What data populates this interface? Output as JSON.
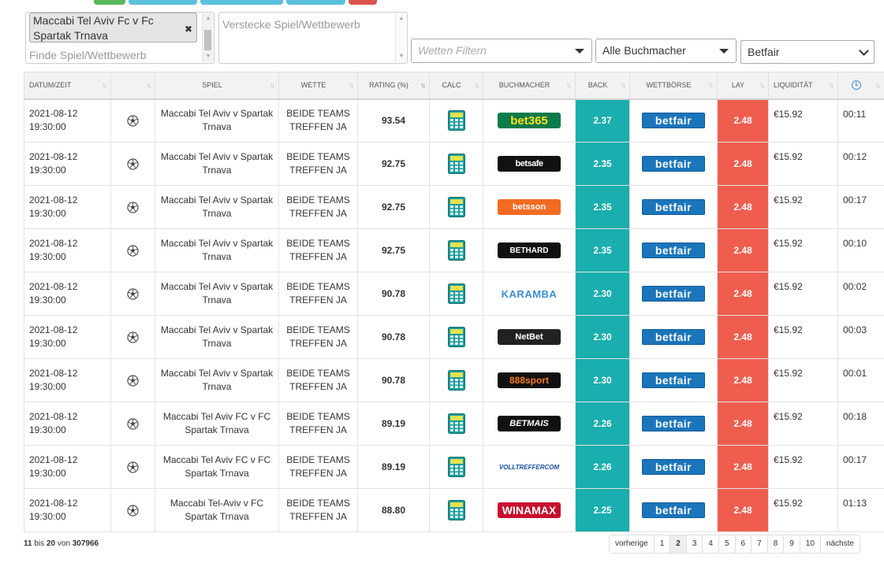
{
  "filters": {
    "match_tag": "Maccabi Tel Aviv Fc v Fc Spartak Trnava",
    "find_placeholder": "Finde Spiel/Wettbewerb",
    "hide_placeholder": "Verstecke Spiel/Wettbewerb",
    "bet_filter_placeholder": "Wetten Filtern",
    "bookmaker_select": "Alle Buchmacher",
    "exchange_select": "Betfair"
  },
  "table": {
    "headers": [
      "Datum/Zeit",
      "",
      "Spiel",
      "Wette",
      "Rating (%)",
      "Calc",
      "Buchmacher",
      "Back",
      "Wettbörse",
      "Lay",
      "Liquidität",
      ""
    ],
    "rows": [
      {
        "date": "2021-08-12",
        "time": "19:30:00",
        "match": "Maccabi Tel Aviv v Spartak Trnava",
        "bet": "BEIDE TEAMS TREFFEN JA",
        "rating": "93.54",
        "bookmaker": "bet365",
        "back": "2.37",
        "exchange": "betfair",
        "lay": "2.48",
        "liquidity": "€15.92",
        "age": "00:11"
      },
      {
        "date": "2021-08-12",
        "time": "19:30:00",
        "match": "Maccabi Tel Aviv v Spartak Trnava",
        "bet": "BEIDE TEAMS TREFFEN JA",
        "rating": "92.75",
        "bookmaker": "betsafe",
        "back": "2.35",
        "exchange": "betfair",
        "lay": "2.48",
        "liquidity": "€15.92",
        "age": "00:12"
      },
      {
        "date": "2021-08-12",
        "time": "19:30:00",
        "match": "Maccabi Tel Aviv v Spartak Trnava",
        "bet": "BEIDE TEAMS TREFFEN JA",
        "rating": "92.75",
        "bookmaker": "betsson",
        "back": "2.35",
        "exchange": "betfair",
        "lay": "2.48",
        "liquidity": "€15.92",
        "age": "00:17"
      },
      {
        "date": "2021-08-12",
        "time": "19:30:00",
        "match": "Maccabi Tel Aviv v Spartak Trnava",
        "bet": "BEIDE TEAMS TREFFEN JA",
        "rating": "92.75",
        "bookmaker": "BETHARD",
        "back": "2.35",
        "exchange": "betfair",
        "lay": "2.48",
        "liquidity": "€15.92",
        "age": "00:10"
      },
      {
        "date": "2021-08-12",
        "time": "19:30:00",
        "match": "Maccabi Tel Aviv v Spartak Trnava",
        "bet": "BEIDE TEAMS TREFFEN JA",
        "rating": "90.78",
        "bookmaker": "KARAMBA",
        "back": "2.30",
        "exchange": "betfair",
        "lay": "2.48",
        "liquidity": "€15.92",
        "age": "00:02"
      },
      {
        "date": "2021-08-12",
        "time": "19:30:00",
        "match": "Maccabi Tel Aviv v Spartak Trnava",
        "bet": "BEIDE TEAMS TREFFEN JA",
        "rating": "90.78",
        "bookmaker": "NetBet",
        "back": "2.30",
        "exchange": "betfair",
        "lay": "2.48",
        "liquidity": "€15.92",
        "age": "00:03"
      },
      {
        "date": "2021-08-12",
        "time": "19:30:00",
        "match": "Maccabi Tel Aviv v Spartak Trnava",
        "bet": "BEIDE TEAMS TREFFEN JA",
        "rating": "90.78",
        "bookmaker": "888sport",
        "back": "2.30",
        "exchange": "betfair",
        "lay": "2.48",
        "liquidity": "€15.92",
        "age": "00:01"
      },
      {
        "date": "2021-08-12",
        "time": "19:30:00",
        "match": "Maccabi Tel Aviv FC v FC Spartak Trnava",
        "bet": "BEIDE TEAMS TREFFEN JA",
        "rating": "89.19",
        "bookmaker": "BETMAIS",
        "back": "2.26",
        "exchange": "betfair",
        "lay": "2.48",
        "liquidity": "€15.92",
        "age": "00:18"
      },
      {
        "date": "2021-08-12",
        "time": "19:30:00",
        "match": "Maccabi Tel Aviv FC v FC Spartak Trnava",
        "bet": "BEIDE TEAMS TREFFEN JA",
        "rating": "89.19",
        "bookmaker": "VOLLTREFFERCOM",
        "back": "2.26",
        "exchange": "betfair",
        "lay": "2.48",
        "liquidity": "€15.92",
        "age": "00:17"
      },
      {
        "date": "2021-08-12",
        "time": "19:30:00",
        "match": "Maccabi Tel-Aviv v FC Spartak Trnava",
        "bet": "BEIDE TEAMS TREFFEN JA",
        "rating": "88.80",
        "bookmaker": "WINAMAX",
        "back": "2.25",
        "exchange": "betfair",
        "lay": "2.48",
        "liquidity": "€15.92",
        "age": "01:13"
      }
    ]
  },
  "footer": {
    "from": "11",
    "sep1": "bis",
    "to": "20",
    "sep2": "von",
    "total": "307966",
    "prev": "vorherige",
    "pages": [
      "1",
      "2",
      "3",
      "4",
      "5",
      "6",
      "7",
      "8",
      "9",
      "10"
    ],
    "current_page": "2",
    "next": "nächste"
  },
  "colors": {
    "back": "#1aaeae",
    "lay": "#ef5d4f",
    "betfair": "#1b75bb"
  }
}
